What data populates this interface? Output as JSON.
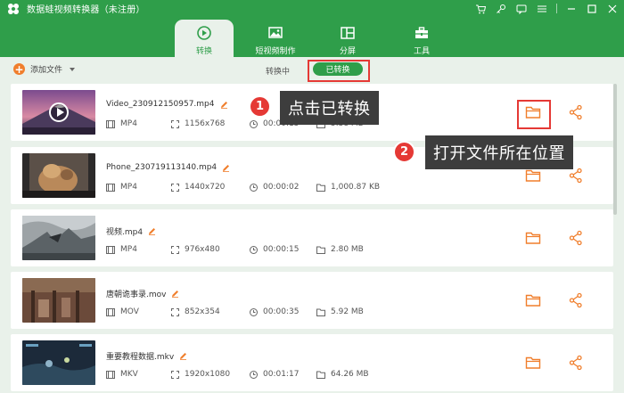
{
  "window": {
    "title": "数据蛙视频转换器（未注册）",
    "controls": [
      "cart-icon",
      "key-icon",
      "feedback-icon",
      "menu-icon",
      "minimize-icon",
      "maximize-icon",
      "close-icon"
    ]
  },
  "nav": {
    "tabs": [
      {
        "label": "转换",
        "icon": "convert-icon",
        "active": true
      },
      {
        "label": "短视频制作",
        "icon": "short-video-icon",
        "active": false
      },
      {
        "label": "分屏",
        "icon": "split-screen-icon",
        "active": false
      },
      {
        "label": "工具",
        "icon": "toolbox-icon",
        "active": false
      }
    ]
  },
  "toolbar": {
    "add_label": "添加文件",
    "converting_label": "转换中",
    "converted_label": "已转换"
  },
  "files": [
    {
      "name": "Video_230912150957.mp4",
      "format": "MP4",
      "resolution": "1156x768",
      "duration": "00:00:15",
      "size": "5.38 MB"
    },
    {
      "name": "Phone_230719113140.mp4",
      "format": "MP4",
      "resolution": "1440x720",
      "duration": "00:00:02",
      "size": "1,000.87 KB"
    },
    {
      "name": "视频.mp4",
      "format": "MP4",
      "resolution": "976x480",
      "duration": "00:00:15",
      "size": "2.80 MB"
    },
    {
      "name": "唐朝诡事录.mov",
      "format": "MOV",
      "resolution": "852x354",
      "duration": "00:00:35",
      "size": "5.92 MB"
    },
    {
      "name": "重要教程数据.mkv",
      "format": "MKV",
      "resolution": "1920x1080",
      "duration": "00:01:17",
      "size": "64.26 MB"
    }
  ],
  "annotations": [
    {
      "number": "1",
      "text": "点击已转换"
    },
    {
      "number": "2",
      "text": "打开文件所在位置"
    }
  ],
  "colors": {
    "primary": "#2f9e4a",
    "accent": "#f07e2c",
    "highlight": "#e53935",
    "callout_bg": "#3d3d3d"
  }
}
